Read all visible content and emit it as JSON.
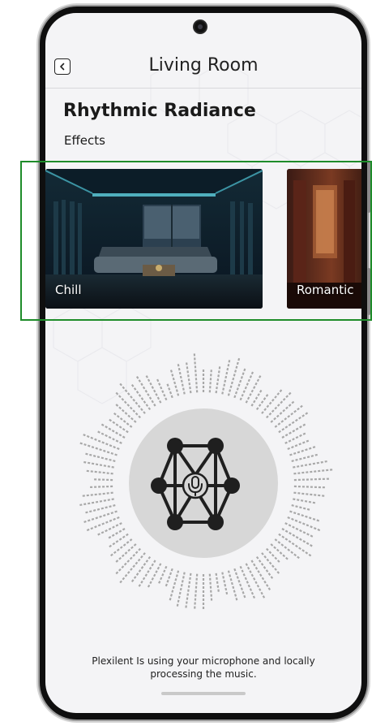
{
  "header": {
    "title": "Living Room",
    "back_icon": "chevron-left-icon"
  },
  "main": {
    "effect_name": "Rhythmic Radiance",
    "section_label": "Effects",
    "effects": [
      {
        "label": "Chill",
        "selected": true
      },
      {
        "label": "Romantic",
        "selected": false
      }
    ],
    "center_icon": "neural-network-microphone-icon",
    "footer_text": "Plexilent Is using your microphone and locally processing the music."
  },
  "colors": {
    "accent": "#1e8c2a",
    "screen_bg": "#f4f4f6",
    "visualizer_bars": "#a8a8a8",
    "center_disc": "#d7d7d7",
    "icon": "#1f1f1f"
  }
}
